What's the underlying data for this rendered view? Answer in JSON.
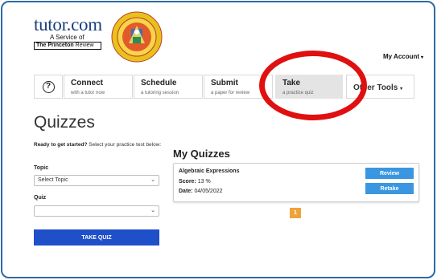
{
  "logo": {
    "tutor_text": "tutor.com",
    "service_text": "A Service of",
    "princeton_bold": "The Princeton",
    "princeton_rest": " Review"
  },
  "seal": {
    "ring_text": "LOS ANGELES UNIFIED SCHOOL DISTRICT · BOARD OF EDUCATION"
  },
  "header": {
    "account_label": "My Account",
    "account_caret": "▾"
  },
  "nav": {
    "help_symbol": "?",
    "tiles": [
      {
        "title": "Connect",
        "subtitle": "with a tutor now"
      },
      {
        "title": "Schedule",
        "subtitle": "a tutoring session"
      },
      {
        "title": "Submit",
        "subtitle": "a paper for review"
      },
      {
        "title": "Take",
        "subtitle": "a practice quiz"
      }
    ],
    "other_tools": "Other Tools",
    "other_caret": "▾"
  },
  "page": {
    "title": "Quizzes"
  },
  "form": {
    "intro_bold": "Ready to get started?",
    "intro_rest": " Select your practice test below:",
    "topic_label": "Topic",
    "topic_value": "Select Topic",
    "quiz_label": "Quiz",
    "quiz_value": "",
    "chevron": "⌄",
    "submit_label": "TAKE QUIZ"
  },
  "quizzes": {
    "title": "My Quizzes",
    "items": [
      {
        "name": "Algebraic Expressions",
        "score_label": "Score:",
        "score_value": " 13 %",
        "date_label": "Date:",
        "date_value": " 04/05/2022",
        "review_label": "Review",
        "retake_label": "Retake"
      }
    ],
    "pagination": {
      "current": "1"
    }
  },
  "colors": {
    "frame": "#2c6aa6",
    "primary_button": "#1f4fc9",
    "card_button": "#3a96e0",
    "pager": "#f0a23a",
    "annotation_ring": "#e01010"
  }
}
